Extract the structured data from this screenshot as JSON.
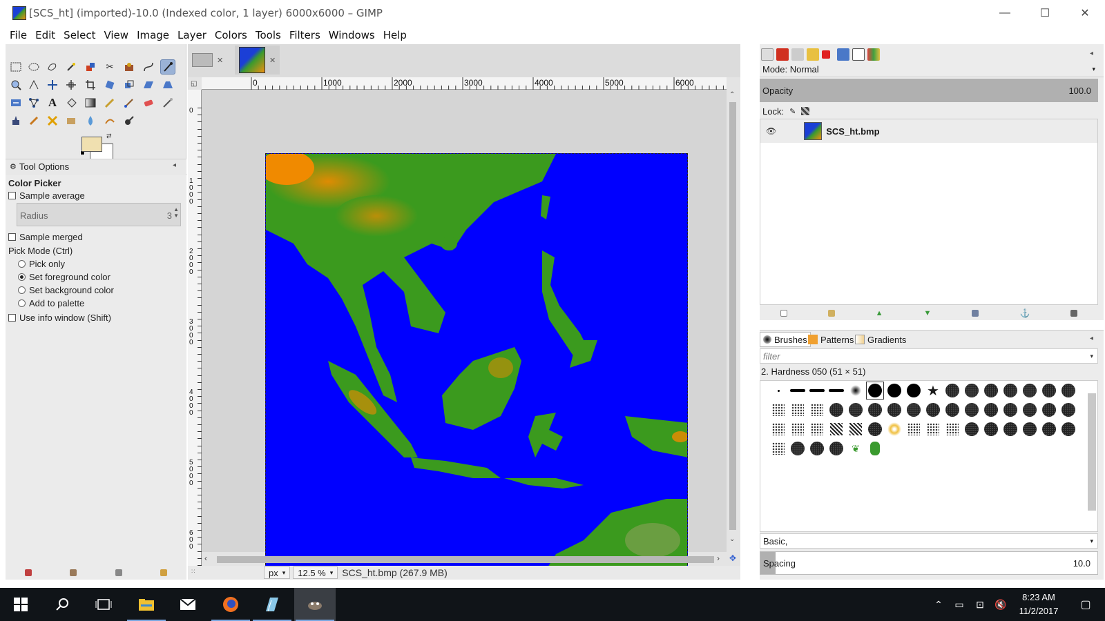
{
  "window": {
    "title": "[SCS_ht] (imported)-10.0 (Indexed color, 1 layer) 6000x6000 – GIMP",
    "icon": "gimp-image-icon",
    "controls": [
      "minimize",
      "maximize",
      "close"
    ]
  },
  "menubar": {
    "items": [
      "File",
      "Edit",
      "Select",
      "View",
      "Image",
      "Layer",
      "Colors",
      "Tools",
      "Filters",
      "Windows",
      "Help"
    ]
  },
  "toolbox": {
    "active_tool": "color-picker",
    "fg_color": "#f0e0b0",
    "bg_color": "#ffffff"
  },
  "tool_options": {
    "header": "Tool Options",
    "tool_name": "Color Picker",
    "sample_average": {
      "label": "Sample average",
      "checked": false
    },
    "radius": {
      "label": "Radius",
      "value": "3"
    },
    "sample_merged": {
      "label": "Sample merged",
      "checked": false
    },
    "pick_mode": {
      "label": "Pick Mode  (Ctrl)",
      "options": [
        "Pick only",
        "Set foreground color",
        "Set background color",
        "Add to palette"
      ],
      "selected": "Set foreground color"
    },
    "use_info_window": {
      "label": "Use info window  (Shift)",
      "checked": false
    }
  },
  "image_window": {
    "tabs": [
      {
        "name": "empty-display"
      },
      {
        "name": "SCS_ht"
      }
    ],
    "ruler_h": [
      "0",
      "1000",
      "2000",
      "3000",
      "4000",
      "5000",
      "6000"
    ],
    "ruler_v": [
      "0",
      "1000",
      "2000",
      "3000",
      "4000",
      "5000",
      "600"
    ],
    "status": {
      "unit": "px",
      "zoom": "12.5 %",
      "info": "SCS_ht.bmp (267.9 MB)"
    },
    "image_colors": {
      "sea": "#0000ff",
      "lowland": "#3b9a1e",
      "highland": "#f08a00"
    }
  },
  "layers": {
    "mode_label": "Mode: Normal",
    "opacity_label": "Opacity",
    "opacity_value": "100.0",
    "lock_label": "Lock:",
    "layer_name": "SCS_ht.bmp"
  },
  "brushes": {
    "tabs": [
      "Brushes",
      "Patterns",
      "Gradients"
    ],
    "filter_placeholder": "filter",
    "selected_brush": "2. Hardness 050 (51 × 51)",
    "preset": "Basic,",
    "spacing_label": "Spacing",
    "spacing_value": "10.0"
  },
  "taskbar": {
    "apps": [
      "start",
      "search",
      "task-view",
      "file-explorer",
      "mail",
      "firefox",
      "notepad",
      "gimp"
    ],
    "time": "8:23 AM",
    "date": "11/2/2017"
  }
}
